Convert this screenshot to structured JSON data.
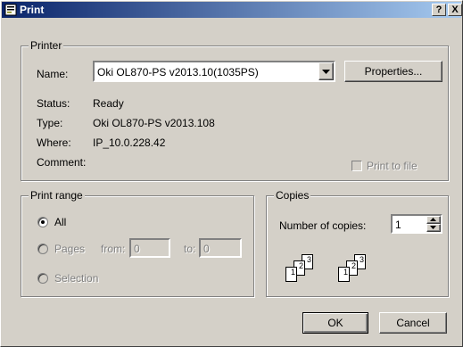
{
  "window": {
    "title": "Print",
    "help_label": "?",
    "close_label": "X"
  },
  "printer": {
    "legend": "Printer",
    "name_label": "Name:",
    "name_value": "Oki OL870-PS v2013.10(1035PS)",
    "properties_label": "Properties...",
    "status_label": "Status:",
    "status_value": "Ready",
    "type_label": "Type:",
    "type_value": "Oki OL870-PS v2013.108",
    "where_label": "Where:",
    "where_value": "IP_10.0.228.42",
    "comment_label": "Comment:",
    "print_to_file_label": "Print to file",
    "print_to_file_checked": false
  },
  "print_range": {
    "legend": "Print range",
    "all_label": "All",
    "pages_label": "Pages",
    "from_label": "from:",
    "from_value": "0",
    "to_label": "to:",
    "to_value": "0",
    "selection_label": "Selection",
    "selected": "All"
  },
  "copies": {
    "legend": "Copies",
    "number_label": "Number of copies:",
    "number_value": "1",
    "page_numbers": [
      "1",
      "2",
      "3"
    ]
  },
  "buttons": {
    "ok_label": "OK",
    "cancel_label": "Cancel"
  }
}
